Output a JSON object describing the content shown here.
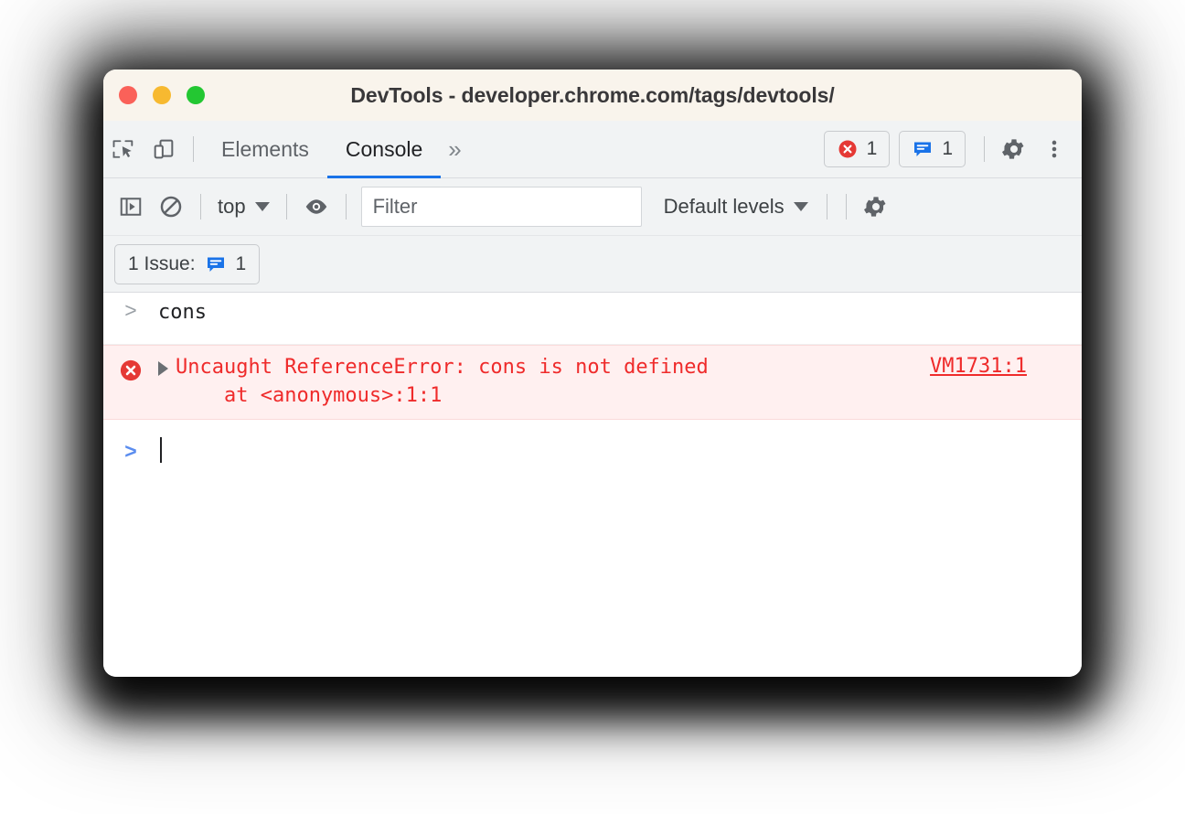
{
  "window": {
    "title": "DevTools - developer.chrome.com/tags/devtools/",
    "traffic_lights": [
      "close-red",
      "minimize-yellow",
      "maximize-green"
    ],
    "colors": {
      "titlebar_bg": "#f9f4ec",
      "toolbar_bg": "#f1f3f4",
      "accent_blue": "#1a73e8",
      "error_red": "#ef2b2b",
      "error_row_bg": "#fff0f0"
    }
  },
  "tabbar": {
    "inspect_icon": "inspect-element-icon",
    "device_icon": "device-toolbar-icon",
    "tabs": [
      {
        "label": "Elements",
        "active": false
      },
      {
        "label": "Console",
        "active": true
      }
    ],
    "more_tabs_label": "»",
    "error_badge": {
      "icon": "error-circle-icon",
      "count": "1"
    },
    "issues_badge": {
      "icon": "issues-speech-bubble-icon",
      "count": "1"
    },
    "settings_icon": "gear-icon",
    "menu_icon": "kebab-menu-icon"
  },
  "console_toolbar": {
    "sidebar_toggle_icon": "console-sidebar-icon",
    "clear_icon": "clear-console-icon",
    "context_label": "top",
    "live_expression_icon": "eye-icon",
    "filter_placeholder": "Filter",
    "filter_value": "",
    "levels_label": "Default levels",
    "settings_icon": "gear-icon"
  },
  "issues_bar": {
    "label": "1 Issue:",
    "icon": "issues-speech-bubble-icon",
    "count": "1"
  },
  "console": {
    "messages": [
      {
        "type": "input",
        "prompt": ">",
        "text": "cons"
      },
      {
        "type": "error",
        "icon": "error-circle-icon",
        "line1": "Uncaught ReferenceError: cons is not defined",
        "line2": "    at <anonymous>:1:1",
        "source_link": "VM1731:1"
      },
      {
        "type": "prompt",
        "prompt": ">",
        "text": ""
      }
    ]
  }
}
